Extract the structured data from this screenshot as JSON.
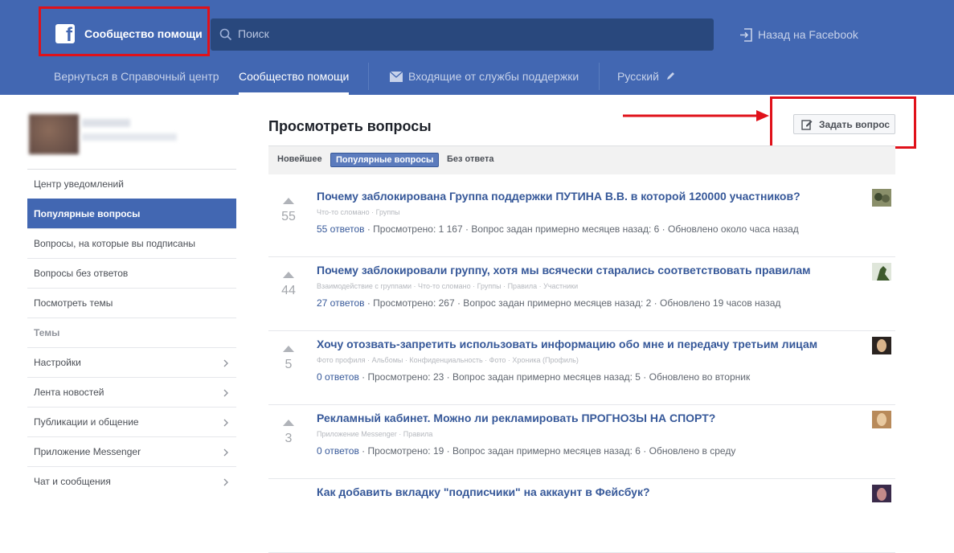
{
  "header": {
    "brand_title": "Сообщество помощи",
    "search_placeholder": "Поиск",
    "back_link": "Назад на Facebook",
    "nav": {
      "help_center": "Вернуться в Справочный центр",
      "community": "Сообщество помощи",
      "inbox": "Входящие от службы поддержки",
      "language": "Русский"
    }
  },
  "sidebar": {
    "items": [
      {
        "label": "Центр уведомлений"
      },
      {
        "label": "Популярные вопросы"
      },
      {
        "label": "Вопросы, на которые вы подписаны"
      },
      {
        "label": "Вопросы без ответов"
      },
      {
        "label": "Посмотреть темы"
      },
      {
        "label": "Темы"
      },
      {
        "label": "Настройки"
      },
      {
        "label": "Лента новостей"
      },
      {
        "label": "Публикации и общение"
      },
      {
        "label": "Приложение Messenger"
      },
      {
        "label": "Чат и сообщения"
      }
    ]
  },
  "main": {
    "title": "Просмотреть вопросы",
    "ask_button": "Задать вопрос",
    "filters": [
      "Новейшее",
      "Популярные вопросы",
      "Без ответа"
    ],
    "questions": [
      {
        "votes": "55",
        "title": "Почему заблокирована Группа поддержки ПУТИНА В.В. в которой 120000 участников?",
        "tags": "Что-то сломано · Группы",
        "answers": "55 ответов",
        "meta": " · Просмотрено: 1 167 · Вопрос задан примерно месяцев назад: 6 · Обновлено около часа назад"
      },
      {
        "votes": "44",
        "title": "Почему заблокировали группу, хотя мы всячески старались соответствовать правилам",
        "tags": "Взаимодействие с группами · Что-то сломано · Группы · Правила · Участники",
        "answers": "27 ответов",
        "meta": " · Просмотрено: 267 · Вопрос задан примерно месяцев назад: 2 · Обновлено 19 часов назад"
      },
      {
        "votes": "5",
        "title": "Хочу отозвать-запретить использовать информацию обо мне и передачу третьим лицам",
        "tags": "Фото профиля · Альбомы · Конфиденциальность · Фото · Хроника (Профиль)",
        "answers": "0 ответов",
        "meta": " · Просмотрено: 23 · Вопрос задан примерно месяцев назад: 5 · Обновлено во вторник"
      },
      {
        "votes": "3",
        "title": "Рекламный кабинет. Можно ли рекламировать ПРОГНОЗЫ НА СПОРТ?",
        "tags": "Приложение Messenger · Правила",
        "answers": "0 ответов",
        "meta": " · Просмотрено: 19 · Вопрос задан примерно месяцев назад: 6 · Обновлено в среду"
      },
      {
        "votes": "",
        "title": "Как добавить вкладку \"подписчики\" на аккаунт в Фейсбук?",
        "tags": "",
        "answers": "",
        "meta": ""
      }
    ]
  },
  "colors": {
    "header_bg": "#4267b2",
    "search_bg": "#29487d",
    "highlight": "#e0111a",
    "link": "#365899"
  }
}
